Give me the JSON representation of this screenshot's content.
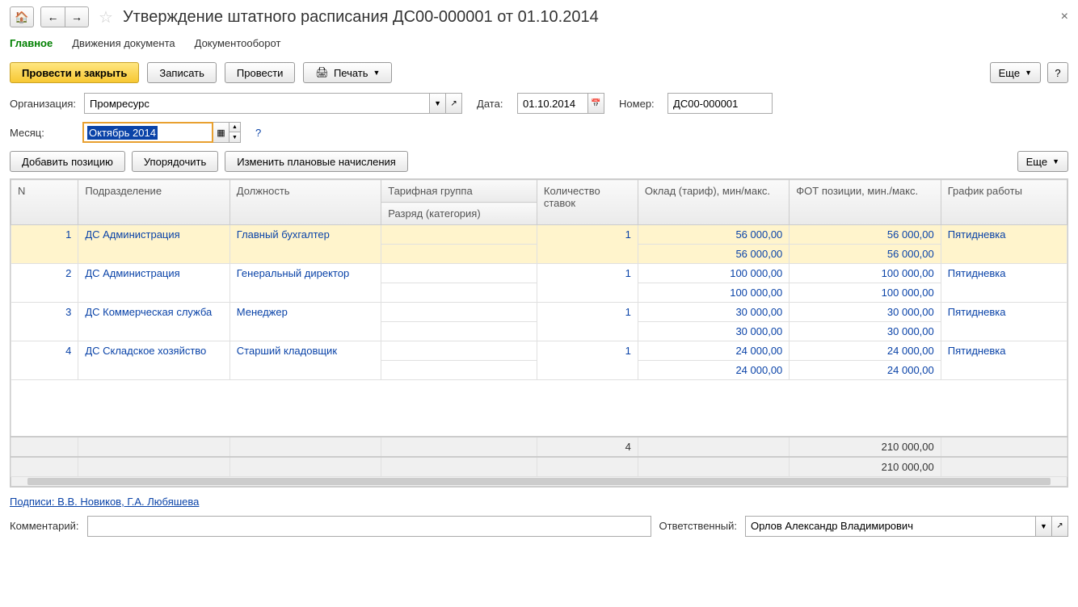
{
  "header": {
    "title": "Утверждение штатного расписания ДС00-000001 от 01.10.2014"
  },
  "tabs": {
    "main": "Главное",
    "movements": "Движения документа",
    "docflow": "Документооборот"
  },
  "toolbar": {
    "post_close": "Провести и закрыть",
    "save": "Записать",
    "post": "Провести",
    "print": "Печать",
    "more": "Еще",
    "help": "?"
  },
  "form": {
    "org_label": "Организация:",
    "org_value": "Промресурс",
    "date_label": "Дата:",
    "date_value": "01.10.2014",
    "num_label": "Номер:",
    "num_value": "ДС00-000001",
    "month_label": "Месяц:",
    "month_value": "Октябрь 2014"
  },
  "table_toolbar": {
    "add": "Добавить позицию",
    "sort": "Упорядочить",
    "change": "Изменить плановые начисления",
    "more": "Еще"
  },
  "columns": {
    "n": "N",
    "dept": "Подразделение",
    "position": "Должность",
    "tariff_group": "Тарифная группа",
    "rank": "Разряд (категория)",
    "qty": "Количество ставок",
    "salary": "Оклад (тариф), мин/макс.",
    "fot": "ФОТ позиции, мин./макс.",
    "schedule": "График работы"
  },
  "rows": [
    {
      "n": "1",
      "dept": "ДС Администрация",
      "pos": "Главный бухгалтер",
      "qty": "1",
      "s_min": "56 000,00",
      "s_max": "56 000,00",
      "f_min": "56 000,00",
      "f_max": "56 000,00",
      "sched": "Пятидневка"
    },
    {
      "n": "2",
      "dept": "ДС Администрация",
      "pos": "Генеральный директор",
      "qty": "1",
      "s_min": "100 000,00",
      "s_max": "100 000,00",
      "f_min": "100 000,00",
      "f_max": "100 000,00",
      "sched": "Пятидневка"
    },
    {
      "n": "3",
      "dept": "ДС Коммерческая служба",
      "pos": "Менеджер",
      "qty": "1",
      "s_min": "30 000,00",
      "s_max": "30 000,00",
      "f_min": "30 000,00",
      "f_max": "30 000,00",
      "sched": "Пятидневка"
    },
    {
      "n": "4",
      "dept": "ДС Складское хозяйство",
      "pos": "Старший кладовщик",
      "qty": "1",
      "s_min": "24 000,00",
      "s_max": "24 000,00",
      "f_min": "24 000,00",
      "f_max": "24 000,00",
      "sched": "Пятидневка"
    }
  ],
  "totals": {
    "qty": "4",
    "fot_min": "210 000,00",
    "fot_max": "210 000,00"
  },
  "signatures": {
    "text": "Подписи: В.В. Новиков, Г.А. Любяшева"
  },
  "footer": {
    "comment_label": "Комментарий:",
    "resp_label": "Ответственный:",
    "resp_value": "Орлов Александр Владимирович"
  }
}
